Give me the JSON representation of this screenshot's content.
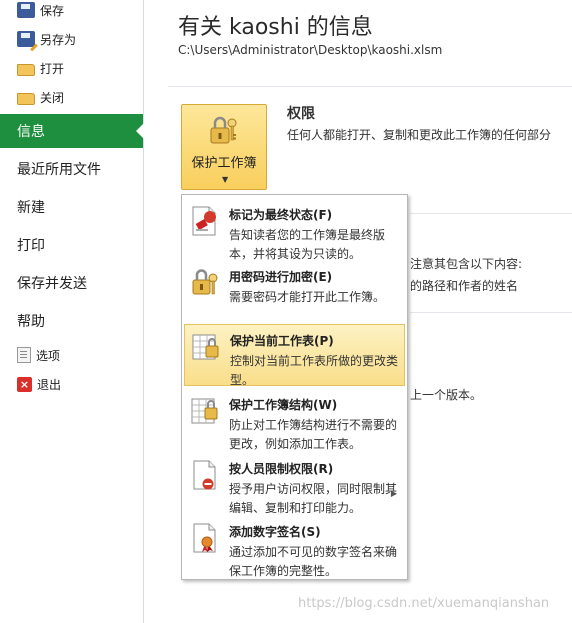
{
  "nav": {
    "small_top": [
      {
        "label": "保存",
        "icon": "save-icon"
      },
      {
        "label": "另存为",
        "icon": "save-as-icon"
      },
      {
        "label": "打开",
        "icon": "open-folder-icon"
      },
      {
        "label": "关闭",
        "icon": "close-folder-icon"
      }
    ],
    "big": [
      {
        "label": "信息",
        "active": true
      },
      {
        "label": "最近所用文件"
      },
      {
        "label": "新建"
      },
      {
        "label": "打印"
      },
      {
        "label": "保存并发送"
      },
      {
        "label": "帮助"
      }
    ],
    "small_bottom": [
      {
        "label": "选项",
        "icon": "options-icon"
      },
      {
        "label": "退出",
        "icon": "exit-icon"
      }
    ],
    "active_color": "#1e8f3e"
  },
  "main": {
    "title": "有关 kaoshi 的信息",
    "path": "C:\\Users\\Administrator\\Desktop\\kaoshi.xlsm",
    "permissions": {
      "button_label": "保护工作簿",
      "title": "权限",
      "description": "任何人都能打开、复制和更改此工作簿的任何部分"
    },
    "behind_text": {
      "line1": "注意其包含以下内容:",
      "line2": "的路径和作者的姓名",
      "line3": "上一个版本。"
    }
  },
  "menu": {
    "items": [
      {
        "title": "标记为最终状态(F)",
        "desc": "告知读者您的工作簿是最终版本，并将其设为只读的。",
        "icon": "mark-final-icon"
      },
      {
        "title": "用密码进行加密(E)",
        "desc": "需要密码才能打开此工作簿。",
        "icon": "encrypt-password-icon"
      },
      {
        "title": "保护当前工作表(P)",
        "desc": "控制对当前工作表所做的更改类型。",
        "icon": "protect-sheet-icon",
        "highlighted": true
      },
      {
        "title": "保护工作簿结构(W)",
        "desc": "防止对工作簿结构进行不需要的更改，例如添加工作表。",
        "icon": "protect-structure-icon"
      },
      {
        "title": "按人员限制权限(R)",
        "desc": "授予用户访问权限，同时限制其编辑、复制和打印能力。",
        "icon": "restrict-permission-icon",
        "has_submenu": true
      },
      {
        "title": "添加数字签名(S)",
        "desc": "通过添加不可见的数字签名来确保工作簿的完整性。",
        "icon": "digital-signature-icon"
      }
    ],
    "highlight_color": "#f9de8a"
  },
  "watermark": "https://blog.csdn.net/xuemanqianshan"
}
